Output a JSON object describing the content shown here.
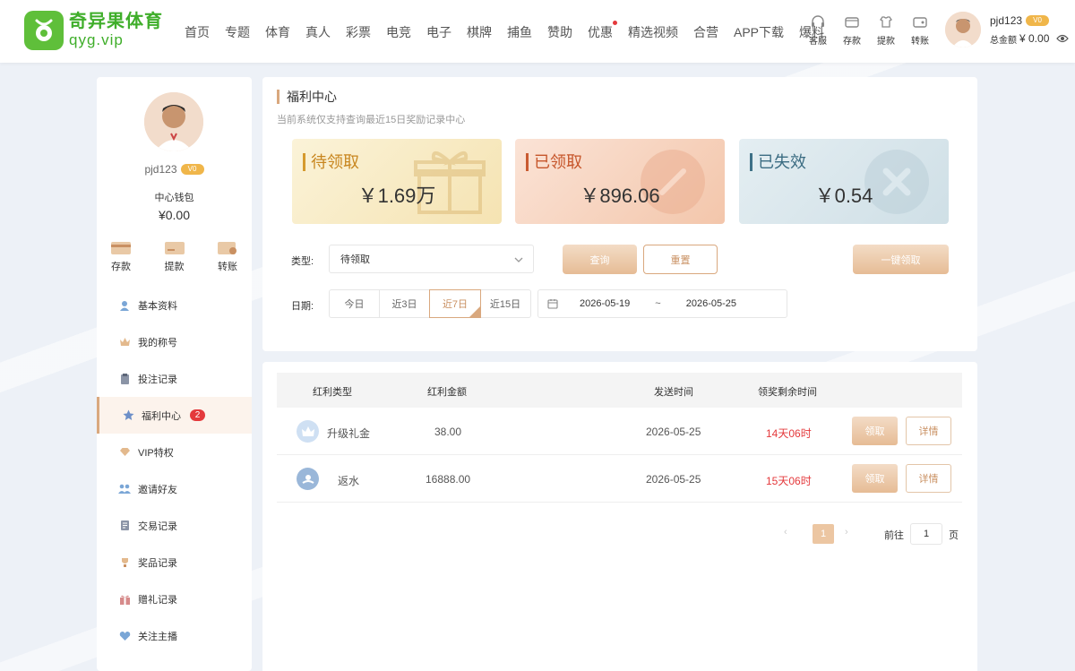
{
  "header": {
    "logo_cn": "奇异果体育",
    "logo_en": "qyg.vip",
    "nav": [
      "首页",
      "专题",
      "体育",
      "真人",
      "彩票",
      "电竞",
      "电子",
      "棋牌",
      "捕鱼",
      "赞助",
      "优惠",
      "精选视频",
      "合营",
      "APP下载",
      "爆料"
    ],
    "quick": [
      {
        "label": "客服",
        "icon": "headset-icon"
      },
      {
        "label": "存款",
        "icon": "wallet-icon"
      },
      {
        "label": "提款",
        "icon": "shirt-icon"
      },
      {
        "label": "转账",
        "icon": "transfer-icon"
      }
    ],
    "username": "pjd123",
    "vip_badge": "V0",
    "balance_label": "总金额",
    "balance": "¥ 0.00"
  },
  "sidebar": {
    "username": "pjd123",
    "vip_badge": "V0",
    "wallet_label": "中心钱包",
    "wallet_amount": "¥0.00",
    "actions": [
      {
        "label": "存款",
        "icon": "deposit-card-icon"
      },
      {
        "label": "提款",
        "icon": "withdraw-card-icon"
      },
      {
        "label": "转账",
        "icon": "transfer-wallet-icon"
      }
    ],
    "menu": [
      {
        "label": "基本资料",
        "icon": "user-icon"
      },
      {
        "label": "我的称号",
        "icon": "crown-icon"
      },
      {
        "label": "投注记录",
        "icon": "clipboard-icon"
      },
      {
        "label": "福利中心",
        "icon": "star-icon",
        "badge": "2",
        "active": true
      },
      {
        "label": "VIP特权",
        "icon": "diamond-icon"
      },
      {
        "label": "邀请好友",
        "icon": "users-icon"
      },
      {
        "label": "交易记录",
        "icon": "document-icon"
      },
      {
        "label": "奖品记录",
        "icon": "trophy-icon"
      },
      {
        "label": "赠礼记录",
        "icon": "gift-icon"
      },
      {
        "label": "关注主播",
        "icon": "heart-icon"
      }
    ]
  },
  "welfare": {
    "title": "福利中心",
    "subtitle": "当前系统仅支持查询最近15日奖励记录中心",
    "cards": [
      {
        "label": "待领取",
        "value": "￥1.69万"
      },
      {
        "label": "已领取",
        "value": "￥896.06"
      },
      {
        "label": "已失效",
        "value": "￥0.54"
      }
    ],
    "filter": {
      "type_label": "类型:",
      "type_value": "待领取",
      "query_button": "查询",
      "reset_button": "重置",
      "claim_all_button": "一键领取",
      "date_label": "日期:",
      "ranges": [
        "今日",
        "近3日",
        "近7日",
        "近15日"
      ],
      "active_range": "近7日",
      "date_start": "2026-05-19",
      "date_sep": "~",
      "date_end": "2026-05-25"
    }
  },
  "table": {
    "headers": [
      "红利类型",
      "红利金额",
      "发送时间",
      "领奖剩余时间"
    ],
    "rows": [
      {
        "type": "升级礼金",
        "amount": "38.00",
        "sent": "2026-05-25",
        "remaining": "14天06时",
        "claim": "领取",
        "detail": "详情",
        "icon": "crown-badge-icon"
      },
      {
        "type": "返水",
        "amount": "16888.00",
        "sent": "2026-05-25",
        "remaining": "15天06时",
        "claim": "领取",
        "detail": "详情",
        "icon": "rebate-badge-icon"
      }
    ],
    "pager": {
      "current": "1",
      "goto_label": "前往",
      "goto_value": "1",
      "unit": "页"
    }
  },
  "colors": {
    "brand_green": "#3fae2a",
    "accent_gold": "#d9a87e",
    "danger_red": "#e4393c"
  }
}
